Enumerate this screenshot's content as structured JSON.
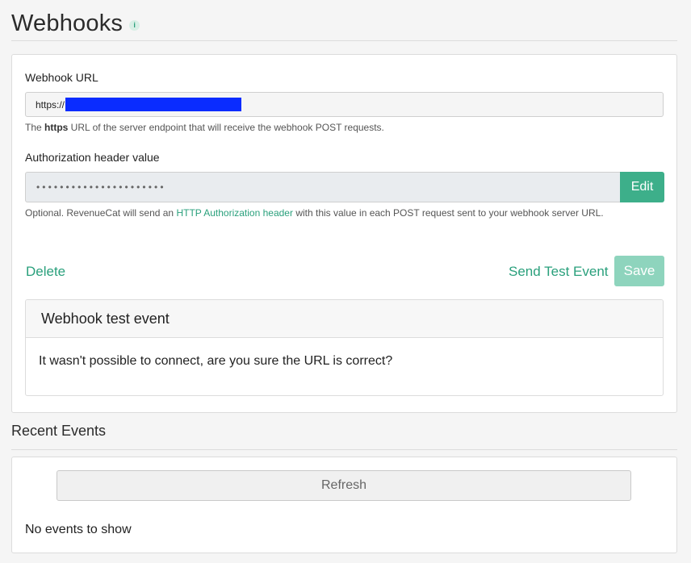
{
  "header": {
    "title": "Webhooks",
    "info_icon": "i"
  },
  "webhook": {
    "url_label": "Webhook URL",
    "url_value": "https://",
    "url_help_prefix": "The ",
    "url_help_bold": "https",
    "url_help_suffix": " URL of the server endpoint that will receive the webhook POST requests.",
    "auth_label": "Authorization header value",
    "auth_value": "••••••••••••••••••••••",
    "edit_label": "Edit",
    "auth_help_prefix": "Optional. RevenueCat will send an ",
    "auth_help_link": "HTTP Authorization header",
    "auth_help_suffix": " with this value in each POST request sent to your webhook server URL.",
    "delete_label": "Delete",
    "send_test_label": "Send Test Event",
    "save_label": "Save"
  },
  "test_event": {
    "title": "Webhook test event",
    "message": "It wasn't possible to connect, are you sure the URL is correct?"
  },
  "recent_events": {
    "title": "Recent Events",
    "refresh_label": "Refresh",
    "empty_message": "No events to show"
  },
  "colors": {
    "accent": "#2aa07c",
    "edit_button": "#3daf8a",
    "save_button_disabled": "#8ed4bd",
    "redaction": "#0a2cff"
  }
}
